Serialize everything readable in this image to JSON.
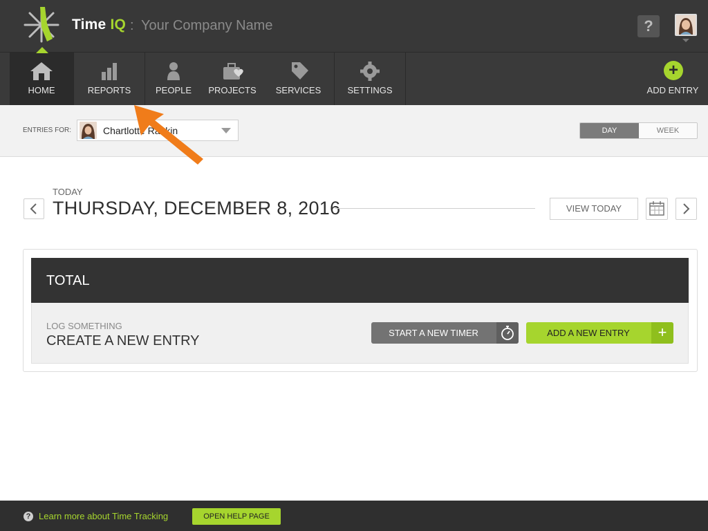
{
  "header": {
    "brand_name": "Time",
    "brand_accent": "IQ",
    "separator": ":",
    "company_name": "Your Company Name",
    "help_label": "?"
  },
  "nav": {
    "items": [
      {
        "label": "HOME",
        "icon": "home-icon"
      },
      {
        "label": "REPORTS",
        "icon": "bar-chart-icon"
      },
      {
        "label": "PEOPLE",
        "icon": "person-icon"
      },
      {
        "label": "PROJECTS",
        "icon": "briefcase-heart-icon"
      },
      {
        "label": "SERVICES",
        "icon": "tag-icon"
      },
      {
        "label": "SETTINGS",
        "icon": "gear-icon"
      }
    ],
    "add_entry_label": "ADD ENTRY",
    "add_entry_symbol": "+"
  },
  "filter": {
    "entries_for_label": "ENTRIES FOR:",
    "selected_person": "Chartlotte Rankin",
    "view_day": "DAY",
    "view_week": "WEEK"
  },
  "date_header": {
    "today_label": "TODAY",
    "date_title": "THURSDAY, DECEMBER 8, 2016",
    "view_today_label": "VIEW TODAY",
    "prev_symbol": "‹",
    "next_symbol": "›"
  },
  "card": {
    "total_label": "TOTAL",
    "log_small": "LOG SOMETHING",
    "log_big": "CREATE A NEW ENTRY",
    "timer_button": "START A NEW TIMER",
    "add_entry_button": "ADD A NEW ENTRY",
    "add_symbol": "+"
  },
  "footer": {
    "help_symbol": "?",
    "learn_more_link": "Learn more about Time Tracking",
    "help_page_button": "OPEN HELP PAGE"
  },
  "colors": {
    "accent": "#a6d52e",
    "header_bg": "#383838",
    "nav_bg": "#3a3a3a",
    "annotation_arrow": "#f07c1a"
  }
}
